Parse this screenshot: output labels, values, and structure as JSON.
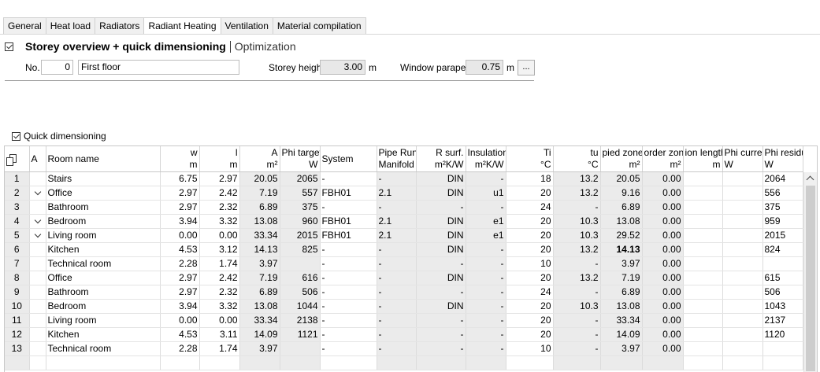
{
  "tabs": [
    {
      "label": "General"
    },
    {
      "label": "Heat load"
    },
    {
      "label": "Radiators"
    },
    {
      "label": "Radiant Heating"
    },
    {
      "label": "Ventilation"
    },
    {
      "label": "Material compilation"
    }
  ],
  "active_tab": "Radiant Heating",
  "section": {
    "title": "Storey overview + quick dimensioning",
    "optimization_label": "Optimization"
  },
  "storey": {
    "no_label": "No.",
    "no_value": "0",
    "name_value": "First floor",
    "height_label": "Storey height",
    "height_value": "3.00",
    "height_unit": "m",
    "parapet_label": "Window parapet",
    "parapet_value": "0.75",
    "parapet_unit": "m",
    "more_button": "..."
  },
  "quick_dimensioning_label": "Quick dimensioning",
  "grid": {
    "columns": [
      {
        "top": "",
        "bottom": ""
      },
      {
        "top": "A",
        "bottom": ""
      },
      {
        "top": "Room name",
        "bottom": ""
      },
      {
        "top": "w",
        "bottom": "m"
      },
      {
        "top": "l",
        "bottom": "m"
      },
      {
        "top": "A",
        "bottom": "m²"
      },
      {
        "top": "Phi target",
        "bottom": "W"
      },
      {
        "top": "System",
        "bottom": ""
      },
      {
        "top": "Pipe Run/",
        "bottom": "Manifold"
      },
      {
        "top": "R surf.",
        "bottom": "m²K/W"
      },
      {
        "top": "Insulation",
        "bottom": "m²K/W"
      },
      {
        "top": "Ti",
        "bottom": "°C"
      },
      {
        "top": "tu",
        "bottom": "°C"
      },
      {
        "top": "pied zone",
        "bottom": "m²"
      },
      {
        "top": "order zone",
        "bottom": "m²"
      },
      {
        "top": "ion length",
        "bottom": "m"
      },
      {
        "top": "Phi curren",
        "bottom": "W"
      },
      {
        "top": "Phi residu",
        "bottom": "W"
      }
    ],
    "rows": [
      [
        "1",
        "",
        "Stairs",
        "6.75",
        "2.97",
        "20.05",
        "2065",
        "-",
        "-",
        "DIN",
        "-",
        "18",
        "13.2",
        "20.05",
        "0.00",
        "",
        "",
        "2064"
      ],
      [
        "2",
        "v",
        "Office",
        "2.97",
        "2.42",
        "7.19",
        "557",
        "FBH01",
        "2.1",
        "DIN",
        "u1",
        "20",
        "13.2",
        "9.16",
        "0.00",
        "",
        "",
        "556"
      ],
      [
        "3",
        "",
        "Bathroom",
        "2.97",
        "2.32",
        "6.89",
        "375",
        "-",
        "-",
        "-",
        "-",
        "24",
        "-",
        "6.89",
        "0.00",
        "",
        "",
        "375"
      ],
      [
        "4",
        "v",
        "Bedroom",
        "3.94",
        "3.32",
        "13.08",
        "960",
        "FBH01",
        "2.1",
        "DIN",
        "e1",
        "20",
        "10.3",
        "13.08",
        "0.00",
        "",
        "",
        "959"
      ],
      [
        "5",
        "v",
        "Living room",
        "0.00",
        "0.00",
        "33.34",
        "2015",
        "FBH01",
        "2.1",
        "DIN",
        "e1",
        "20",
        "10.3",
        "29.52",
        "0.00",
        "",
        "",
        "2015"
      ],
      [
        "6",
        "",
        "Kitchen",
        "4.53",
        "3.12",
        "14.13",
        "825",
        "-",
        "-",
        "DIN",
        "-",
        "20",
        "13.2",
        "14.13",
        "0.00",
        "",
        "",
        "824"
      ],
      [
        "7",
        "",
        "Technical room",
        "2.28",
        "1.74",
        "3.97",
        "",
        "-",
        "-",
        "-",
        "-",
        "10",
        "-",
        "3.97",
        "0.00",
        "",
        "",
        ""
      ],
      [
        "8",
        "",
        "Office",
        "2.97",
        "2.42",
        "7.19",
        "616",
        "-",
        "-",
        "DIN",
        "-",
        "20",
        "13.2",
        "7.19",
        "0.00",
        "",
        "",
        "615"
      ],
      [
        "9",
        "",
        "Bathroom",
        "2.97",
        "2.32",
        "6.89",
        "506",
        "-",
        "-",
        "-",
        "-",
        "24",
        "-",
        "6.89",
        "0.00",
        "",
        "",
        "506"
      ],
      [
        "10",
        "",
        "Bedroom",
        "3.94",
        "3.32",
        "13.08",
        "1044",
        "-",
        "-",
        "DIN",
        "-",
        "20",
        "10.3",
        "13.08",
        "0.00",
        "",
        "",
        "1043"
      ],
      [
        "11",
        "",
        "Living room",
        "0.00",
        "0.00",
        "33.34",
        "2138",
        "-",
        "-",
        "-",
        "-",
        "20",
        "-",
        "33.34",
        "0.00",
        "",
        "",
        "2137"
      ],
      [
        "12",
        "",
        "Kitchen",
        "4.53",
        "3.11",
        "14.09",
        "1121",
        "-",
        "-",
        "-",
        "-",
        "20",
        "-",
        "14.09",
        "0.00",
        "",
        "",
        "1120"
      ],
      [
        "13",
        "",
        "Technical room",
        "2.28",
        "1.74",
        "3.97",
        "",
        "-",
        "-",
        "-",
        "-",
        "10",
        "-",
        "3.97",
        "0.00",
        "",
        "",
        ""
      ]
    ]
  },
  "colors": {
    "tab_bg": "#f0f0f0",
    "readonly_bg": "#e8e8e8",
    "shaded_cell": "#ebebeb",
    "grid_line": "#dcdcdc"
  }
}
